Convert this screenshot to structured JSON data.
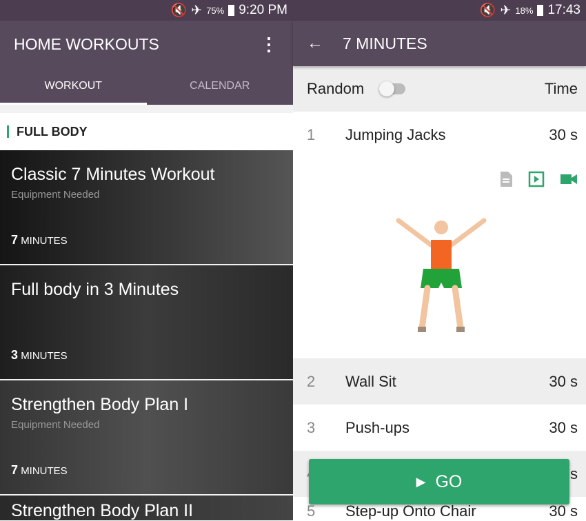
{
  "left": {
    "status": {
      "battery": "75%",
      "time": "9:20 PM"
    },
    "title": "HOME WORKOUTS",
    "tabs": [
      {
        "label": "WORKOUT",
        "active": true
      },
      {
        "label": "CALENDAR",
        "active": false
      }
    ],
    "section": "FULL BODY",
    "cards": [
      {
        "title": "Classic 7 Minutes Workout",
        "sub": "Equipment Needed",
        "num": "7",
        "unit": "MINUTES"
      },
      {
        "title": "Full body in 3 Minutes",
        "sub": "",
        "num": "3",
        "unit": "MINUTES"
      },
      {
        "title": "Strengthen Body Plan I",
        "sub": "Equipment Needed",
        "num": "7",
        "unit": "MINUTES"
      },
      {
        "title": "Strengthen Body Plan II",
        "sub": "",
        "num": "",
        "unit": ""
      }
    ]
  },
  "right": {
    "status": {
      "battery": "18%",
      "time": "17:43"
    },
    "title": "7 MINUTES",
    "random_label": "Random",
    "random_on": false,
    "time_label": "Time",
    "exercises": [
      {
        "num": "1",
        "name": "Jumping Jacks",
        "time": "30 s"
      },
      {
        "num": "2",
        "name": "Wall Sit",
        "time": "30 s"
      },
      {
        "num": "3",
        "name": "Push-ups",
        "time": "30 s"
      },
      {
        "num": "4",
        "name": "",
        "time": "30 s"
      },
      {
        "num": "5",
        "name": "Step-up Onto Chair",
        "time": "30 s"
      }
    ],
    "go_label": "GO",
    "accent": "#2ea56c"
  }
}
